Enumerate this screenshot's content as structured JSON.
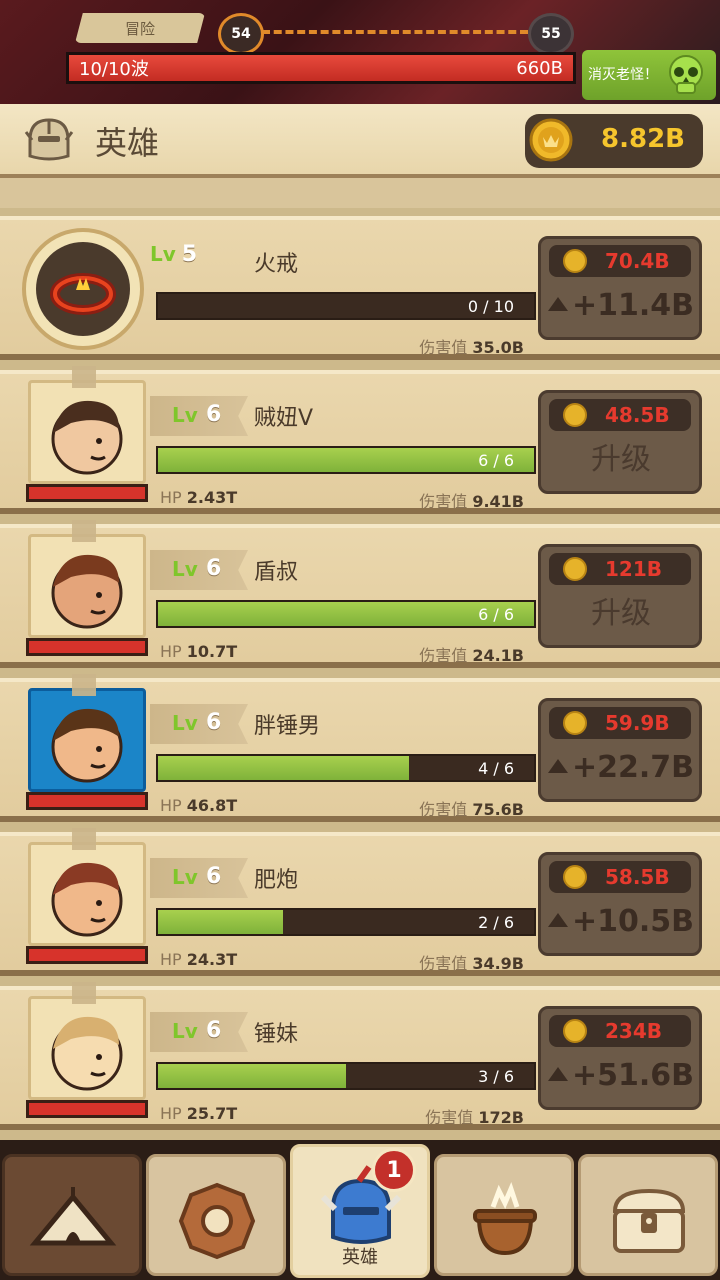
{
  "hud": {
    "stage_label": "冒险",
    "current_stage": "54",
    "next_stage": "55",
    "wave_text": "10/10波",
    "boss_hp": "660B",
    "boss_button": "消灭老怪！"
  },
  "header": {
    "title": "英雄",
    "gold": "8.82B"
  },
  "item": {
    "level_prefix": "Lv",
    "level": "5",
    "name": "火戒",
    "progress_text": "0 / 10",
    "progress": 0.0,
    "damage_label": "伤害值",
    "damage": "35.0B",
    "cost": "70.4B",
    "gain": "+11.4B"
  },
  "heroes": [
    {
      "level_prefix": "Lv",
      "level": "6",
      "name": "贼妞V",
      "progress_text": "6 / 6",
      "progress": 1.0,
      "hp_label": "HP",
      "hp": "2.43T",
      "damage_label": "伤害值",
      "damage": "9.41B",
      "cost": "48.5B",
      "action": "升级"
    },
    {
      "level_prefix": "Lv",
      "level": "6",
      "name": "盾叔",
      "progress_text": "6 / 6",
      "progress": 1.0,
      "hp_label": "HP",
      "hp": "10.7T",
      "damage_label": "伤害值",
      "damage": "24.1B",
      "cost": "121B",
      "action": "升级"
    },
    {
      "level_prefix": "Lv",
      "level": "6",
      "name": "胖锤男",
      "progress_text": "4 / 6",
      "progress": 0.667,
      "hp_label": "HP",
      "hp": "46.8T",
      "damage_label": "伤害值",
      "damage": "75.6B",
      "cost": "59.9B",
      "action": "+22.7B"
    },
    {
      "level_prefix": "Lv",
      "level": "6",
      "name": "肥炮",
      "progress_text": "2 / 6",
      "progress": 0.333,
      "hp_label": "HP",
      "hp": "24.3T",
      "damage_label": "伤害值",
      "damage": "34.9B",
      "cost": "58.5B",
      "action": "+10.5B"
    },
    {
      "level_prefix": "Lv",
      "level": "6",
      "name": "锤妹",
      "progress_text": "3 / 6",
      "progress": 0.5,
      "hp_label": "HP",
      "hp": "25.7T",
      "damage_label": "伤害值",
      "damage": "172B",
      "cost": "234B",
      "action": "+51.6B"
    }
  ],
  "nav": {
    "active_label": "英雄",
    "badge": "1"
  },
  "colors": {
    "gold": "#f6c52d",
    "cost_red": "#e63a2e",
    "level_green": "#7fc62b",
    "bar_green": "#8fc43a",
    "hp_red": "#d7332b"
  }
}
